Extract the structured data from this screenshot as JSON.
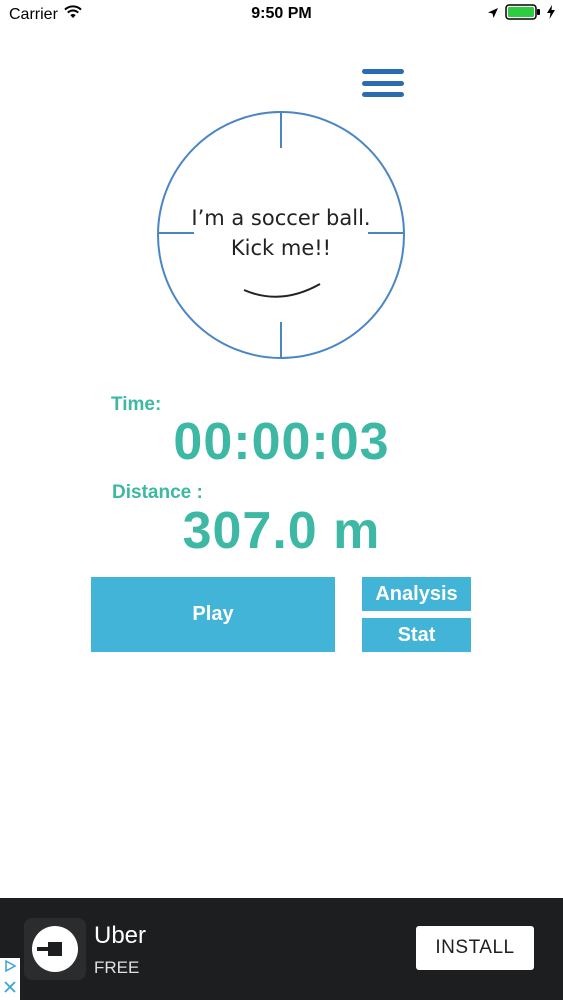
{
  "status_bar": {
    "carrier": "Carrier",
    "time": "9:50 PM"
  },
  "ball": {
    "line1": "I’m a soccer ball.",
    "line2": "Kick me!!"
  },
  "time": {
    "label": "Time:",
    "value": "00:00:03"
  },
  "distance": {
    "label": "Distance :",
    "value": "307.0 m"
  },
  "buttons": {
    "play": "Play",
    "analysis": "Analysis",
    "stat": "Stat"
  },
  "ad": {
    "title": "Uber",
    "subtitle": "FREE",
    "install": "INSTALL"
  },
  "colors": {
    "accent_teal": "#3db8a4",
    "button_blue": "#42b4d8",
    "menu_blue": "#2b6cb0",
    "ball_outline": "#4a86c5",
    "ad_background": "#1d1e20"
  },
  "icons": [
    "wifi-icon",
    "location-arrow-icon",
    "battery-icon",
    "charging-bolt-icon",
    "menu-icon",
    "uber-logo-icon",
    "adchoices-icon",
    "close-icon"
  ]
}
